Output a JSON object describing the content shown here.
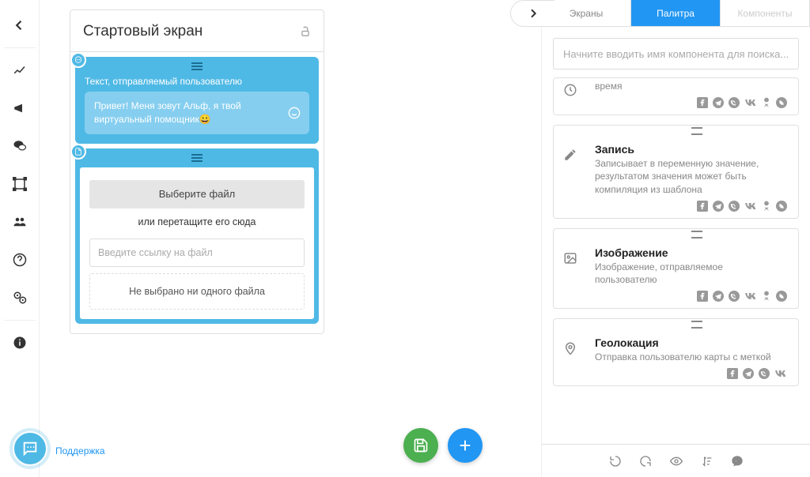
{
  "leftRail": {
    "icons": [
      "arrow-left",
      "chart",
      "megaphone",
      "comments",
      "frame",
      "users",
      "help",
      "gear",
      "info"
    ]
  },
  "screen": {
    "title": "Стартовый экран",
    "textComponent": {
      "label": "Текст, отправляемый пользователю",
      "message": "Привет! Меня зовут Альф, я твой виртуальный помощник😀"
    },
    "fileComponent": {
      "buttonLabel": "Выберите файл",
      "dragText": "или перетащите его сюда",
      "urlPlaceholder": "Введите ссылку на файл",
      "noFilesText": "Не выбрано ни одного файла"
    }
  },
  "supportLabel": "Поддержка",
  "rightPanel": {
    "tabs": {
      "screens": "Экраны",
      "palette": "Палитра",
      "components": "Компоненты"
    },
    "searchPlaceholder": "Начните вводить имя компонента для поиска...",
    "items": [
      {
        "title": "",
        "desc": "время",
        "icon": "clock",
        "channels": [
          "fb",
          "tg",
          "viber",
          "vk",
          "ok",
          "wa"
        ],
        "cut": true
      },
      {
        "title": "Запись",
        "desc": "Записывает в переменную значение, результатом значения может быть компиляция из шаблона",
        "icon": "pencil",
        "channels": [
          "fb",
          "tg",
          "viber",
          "vk",
          "ok",
          "wa"
        ]
      },
      {
        "title": "Изображение",
        "desc": "Изображение, отправляемое пользователю",
        "icon": "image",
        "channels": [
          "fb",
          "tg",
          "viber",
          "vk",
          "ok",
          "wa"
        ]
      },
      {
        "title": "Геолокация",
        "desc": "Отправка пользователю карты с меткой",
        "icon": "pin",
        "channels": [
          "fb",
          "tg",
          "viber",
          "vk"
        ]
      }
    ]
  }
}
